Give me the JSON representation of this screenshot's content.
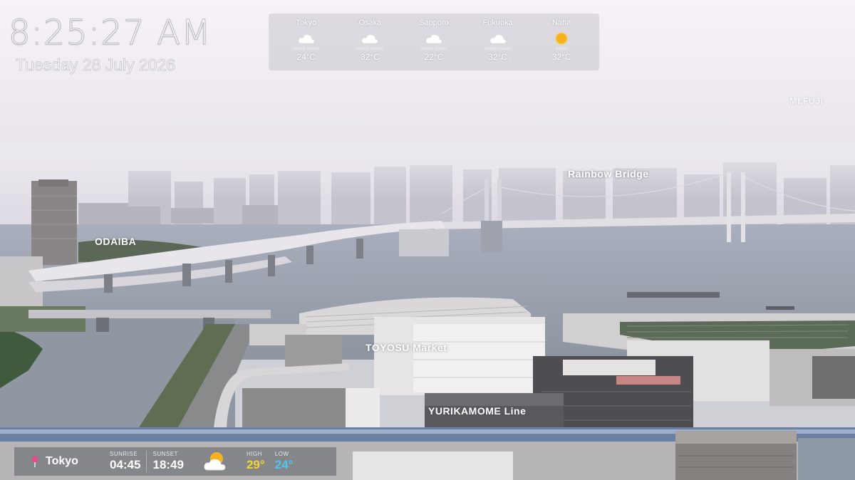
{
  "clock": {
    "time": "8:25:27 AM",
    "date": "Tuesday 28 July 2026"
  },
  "forecast": [
    {
      "city": "Tokyo",
      "icon": "cloud-icon",
      "condition": "Mostly cloudy",
      "temp": "24°C"
    },
    {
      "city": "Osaka",
      "icon": "cloud-icon",
      "condition": "Mostly cloudy",
      "temp": "32°C"
    },
    {
      "city": "Sapporo",
      "icon": "cloud-icon",
      "condition": "Mostly cloudy",
      "temp": "22°C"
    },
    {
      "city": "Fukuoka",
      "icon": "cloud-icon",
      "condition": "Mostly cloudy",
      "temp": "32°C"
    },
    {
      "city": "Naha",
      "icon": "sun-icon",
      "condition": "Sunny",
      "temp": "32°C"
    }
  ],
  "labels": {
    "rainbow_bridge": "Rainbow Bridge",
    "odaiba": "ODAIBA",
    "toyosu": "TOYOSU Market",
    "yurikamome": "YURIKAMOME Line",
    "mt_fuji": "Mt.FUJI"
  },
  "bottom": {
    "location": "Tokyo",
    "sunrise_label": "SUNRISE",
    "sunrise": "04:45",
    "sunset_label": "SUNSET",
    "sunset": "18:49",
    "high_label": "HIGH",
    "high": "29°",
    "low_label": "LOW",
    "low": "24°",
    "icon": "partly-cloudy-icon"
  },
  "colors": {
    "high": "#f4d23a",
    "low": "#4fc4f0",
    "sun": "#f7b21c"
  }
}
